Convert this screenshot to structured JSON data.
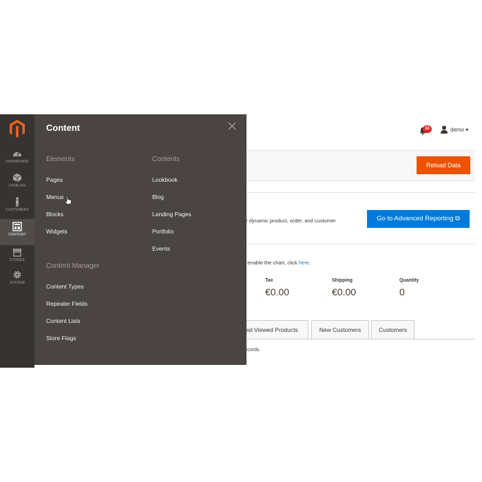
{
  "sidebar": {
    "logo_icon": "magento-logo-icon",
    "items": [
      {
        "label": "DASHBOARD",
        "icon": "speedometer-icon",
        "active": false
      },
      {
        "label": "CATALOG",
        "icon": "box-icon",
        "active": false
      },
      {
        "label": "CUSTOMERS",
        "icon": "person-icon",
        "active": false
      },
      {
        "label": "CONTENT",
        "icon": "layout-icon",
        "active": true
      },
      {
        "label": "STORES",
        "icon": "storefront-icon",
        "active": false
      },
      {
        "label": "SYSTEM",
        "icon": "gear-icon",
        "active": false
      }
    ]
  },
  "flyout": {
    "title": "Content",
    "elements_heading": "Elements",
    "elements": [
      "Pages",
      "Menus",
      "Blocks",
      "Widgets"
    ],
    "contents_heading": "Contents",
    "contents": [
      "Lookbook",
      "Blog",
      "Landing Pages",
      "Portfolio",
      "Events"
    ],
    "manager_heading": "Content Manager",
    "manager": [
      "Content Types",
      "Repeater Fields",
      "Content Lists",
      "Store Flags"
    ]
  },
  "header": {
    "notification_count": "33",
    "user_name": "demo"
  },
  "actions": {
    "reload": "Reload Data"
  },
  "advanced": {
    "text": "ur dynamic product, order, and customer",
    "button": "Go to Advanced Reporting"
  },
  "chart": {
    "text_before": "o enable the chart, click ",
    "link": "here",
    "text_after": "."
  },
  "stats": [
    {
      "label": "Tax",
      "value": "€0.00"
    },
    {
      "label": "Shipping",
      "value": "€0.00"
    },
    {
      "label": "Quantity",
      "value": "0"
    }
  ],
  "tabs": [
    "Most Viewed Products",
    "New Customers",
    "Customers"
  ],
  "records_text": "records.",
  "colors": {
    "sidebar": "#373330",
    "flyout": "#4a4542",
    "reload": "#eb5202",
    "advanced": "#007bdb",
    "badge": "#e22626"
  }
}
